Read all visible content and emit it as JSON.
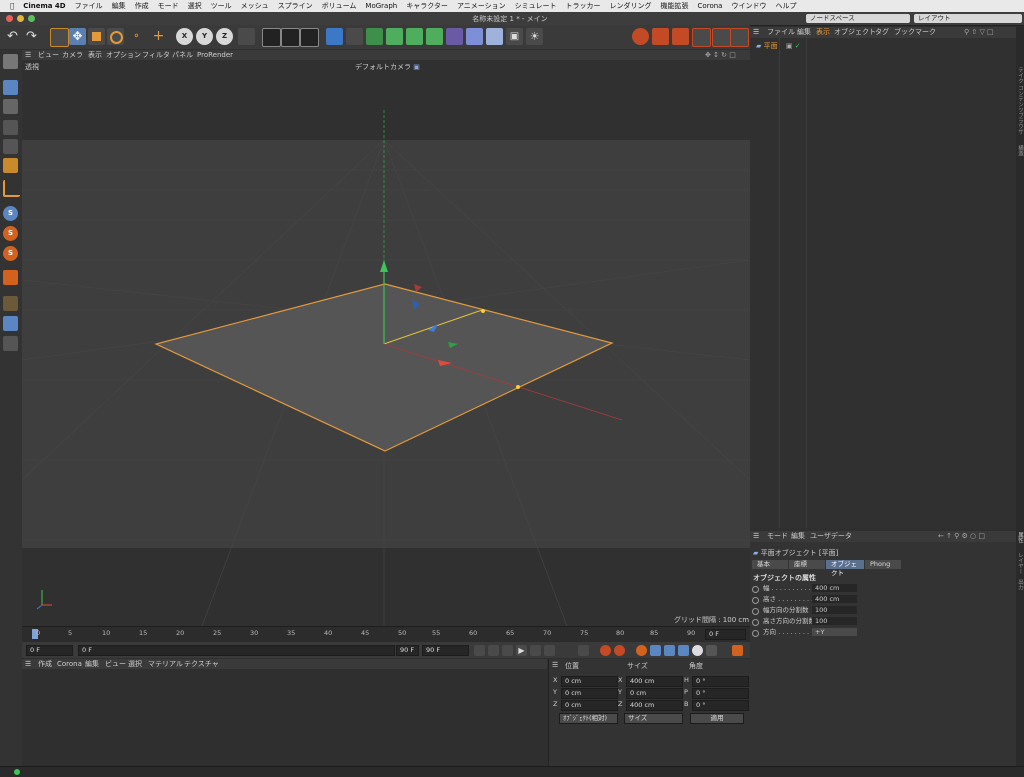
{
  "mac_menu": {
    "app": "Cinema 4D",
    "items": [
      "ファイル",
      "編集",
      "作成",
      "モード",
      "選択",
      "ツール",
      "メッシュ",
      "スプライン",
      "ボリューム",
      "MoGraph",
      "キャラクター",
      "アニメーション",
      "シミュレート",
      "トラッカー",
      "レンダリング",
      "機能拡張",
      "Corona",
      "ウインドウ",
      "ヘルプ"
    ]
  },
  "window": {
    "title": "名称未設定 1 * - メイン",
    "node_space": "ノードスペース",
    "layout": "レイアウト"
  },
  "viewport": {
    "menu": [
      "ビュー",
      "カメラ",
      "表示",
      "オプション",
      "フィルタ",
      "パネル",
      "ProRender"
    ],
    "mode_label": "透視",
    "camera_label": "デフォルトカメラ",
    "grid_info": "グリッド間隔 : 100 cm"
  },
  "timeline": {
    "ticks": [
      "0",
      "5",
      "10",
      "15",
      "20",
      "25",
      "30",
      "35",
      "40",
      "45",
      "50",
      "55",
      "60",
      "65",
      "70",
      "75",
      "80",
      "85",
      "90"
    ],
    "end_frame": "0 F"
  },
  "playback": {
    "start": "0 F",
    "current": "0 F",
    "end1": "90 F",
    "end2": "90 F"
  },
  "material_menu": [
    "作成",
    "Corona",
    "編集",
    "ビュー",
    "選択",
    "マテリアル",
    "テクスチャ"
  ],
  "coords": {
    "headers": [
      "位置",
      "サイズ",
      "角度"
    ],
    "rows": [
      {
        "axis": "X",
        "pos": "0 cm",
        "size_axis": "X",
        "size": "400 cm",
        "rot_axis": "H",
        "rot": "0 °"
      },
      {
        "axis": "Y",
        "pos": "0 cm",
        "size_axis": "Y",
        "size": "0 cm",
        "rot_axis": "P",
        "rot": "0 °"
      },
      {
        "axis": "Z",
        "pos": "0 cm",
        "size_axis": "Z",
        "size": "400 cm",
        "rot_axis": "B",
        "rot": "0 °"
      }
    ],
    "mode": "ｵﾌﾞｼﾞｪｸﾄ(相対)",
    "size_mode": "サイズ",
    "apply": "適用"
  },
  "object_manager": {
    "menu": [
      "ファイル",
      "編集",
      "表示",
      "オブジェクト",
      "タグ",
      "ブックマーク"
    ],
    "object_name": "平面"
  },
  "attributes": {
    "menu": [
      "モード",
      "編集",
      "ユーザデータ"
    ],
    "title": "平面オブジェクト [平面]",
    "tabs": [
      "基本",
      "座標",
      "オブジェクト",
      "Phong"
    ],
    "active_tab": "オブジェクト",
    "section": "オブジェクトの属性",
    "props": [
      {
        "label": "幅 . . . . . . . . . .",
        "value": "400 cm"
      },
      {
        "label": "高さ . . . . . . . . .",
        "value": "400 cm"
      },
      {
        "label": "幅方向の分割数",
        "value": "100"
      },
      {
        "label": "高さ方向の分割数",
        "value": "100"
      },
      {
        "label": "方向 . . . . . . . .",
        "value": "+Y"
      }
    ]
  },
  "right_tabs": [
    "テイク",
    "コンテンツブラウザ",
    "構造",
    "属性",
    "レイヤー",
    "出力"
  ],
  "colors": {
    "selection_orange": "#e39a3c",
    "axis_y": "#3ec45a",
    "axis_x": "#e24a3a",
    "axis_z": "#3a7de2",
    "pointer_yellow": "#c9c42a"
  },
  "icons": {
    "undo": "undo-icon",
    "redo": "redo-icon",
    "pointer": "hand-pointer-icon"
  }
}
